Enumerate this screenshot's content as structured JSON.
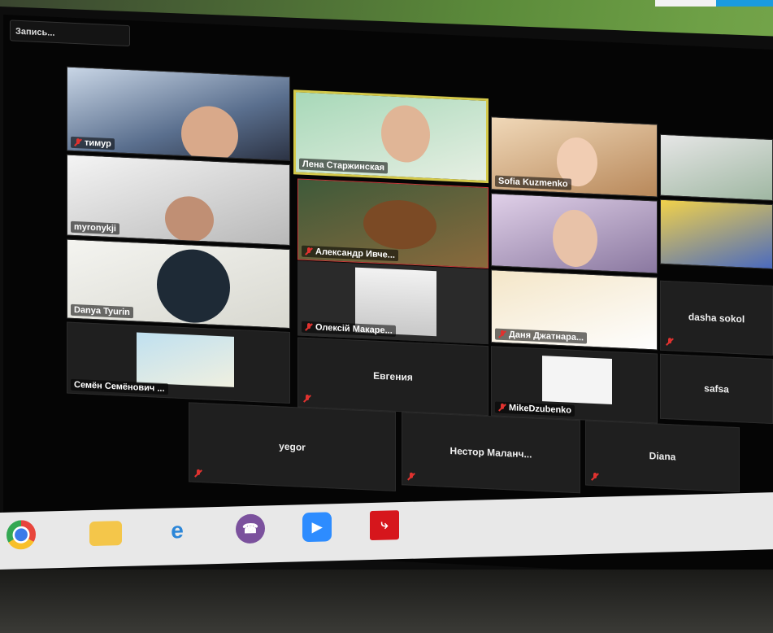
{
  "recording_label": "Запись...",
  "participants": [
    {
      "id": "timur",
      "name": "тимур"
    },
    {
      "id": "lena",
      "name": "Лена Старжинская"
    },
    {
      "id": "sofia",
      "name": "Sofia Kuzmenko"
    },
    {
      "id": "myronyk",
      "name": "myronykji"
    },
    {
      "id": "alexandr",
      "name": "Александр Ивче..."
    },
    {
      "id": "danya",
      "name": "Danya Tyurin"
    },
    {
      "id": "oleksii",
      "name": "Олексій Макаре..."
    },
    {
      "id": "dana",
      "name": "Даня Джатнара..."
    },
    {
      "id": "dasha",
      "name": "dasha sokol"
    },
    {
      "id": "semen",
      "name": "Семён Семёнович ..."
    },
    {
      "id": "evgenia",
      "name": "Евгения"
    },
    {
      "id": "mike",
      "name": "MikeDzubenko"
    },
    {
      "id": "safsa",
      "name": "safsa"
    },
    {
      "id": "yegor",
      "name": "yegor"
    },
    {
      "id": "nestor",
      "name": "Нестор Маланч..."
    },
    {
      "id": "diana",
      "name": "Diana"
    }
  ],
  "taskbar": {
    "apps": [
      {
        "icon": "chrome-icon"
      },
      {
        "icon": "file-explorer-icon"
      },
      {
        "icon": "internet-explorer-icon"
      },
      {
        "icon": "viber-icon"
      },
      {
        "icon": "zoom-icon"
      },
      {
        "icon": "acrobat-icon"
      }
    ]
  },
  "colors": {
    "active_speaker_border": "#d4c94a",
    "mute_red": "#e0322f",
    "wall_green": "#6ea046"
  }
}
